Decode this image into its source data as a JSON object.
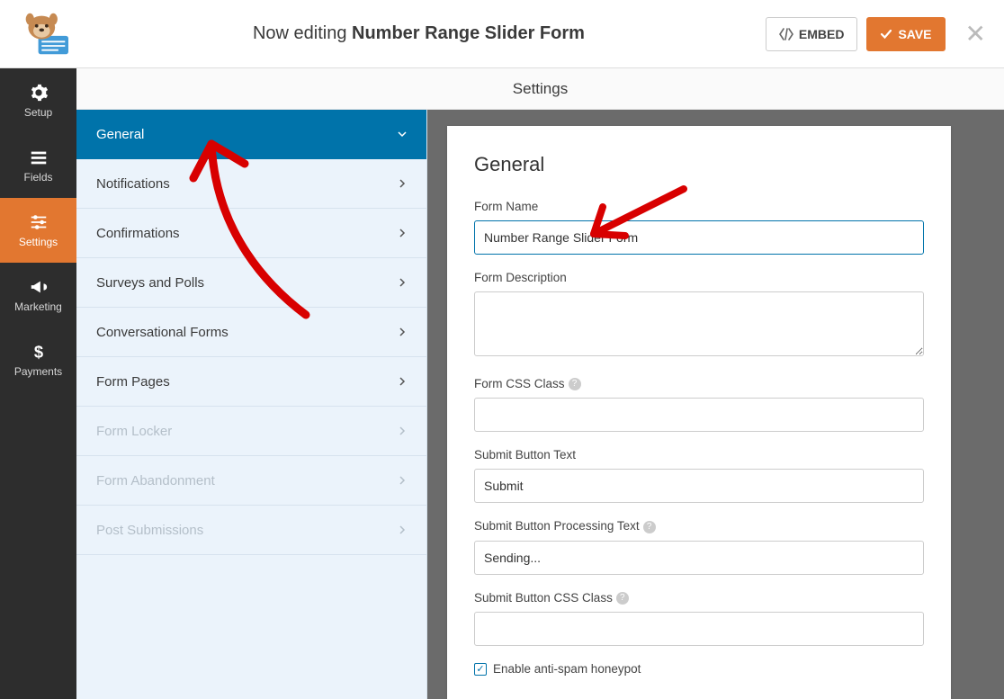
{
  "header": {
    "editing_prefix": "Now editing ",
    "editing_title": "Number Range Slider Form",
    "embed_label": "EMBED",
    "save_label": "SAVE"
  },
  "sidebar": {
    "items": [
      {
        "label": "Setup",
        "icon": "gear"
      },
      {
        "label": "Fields",
        "icon": "list"
      },
      {
        "label": "Settings",
        "icon": "sliders"
      },
      {
        "label": "Marketing",
        "icon": "bullhorn"
      },
      {
        "label": "Payments",
        "icon": "dollar"
      }
    ]
  },
  "section_title": "Settings",
  "menu": {
    "items": [
      {
        "label": "General",
        "active": true,
        "disabled": false
      },
      {
        "label": "Notifications",
        "disabled": false
      },
      {
        "label": "Confirmations",
        "disabled": false
      },
      {
        "label": "Surveys and Polls",
        "disabled": false
      },
      {
        "label": "Conversational Forms",
        "disabled": false
      },
      {
        "label": "Form Pages",
        "disabled": false
      },
      {
        "label": "Form Locker",
        "disabled": true
      },
      {
        "label": "Form Abandonment",
        "disabled": true
      },
      {
        "label": "Post Submissions",
        "disabled": true
      }
    ]
  },
  "panel": {
    "title": "General",
    "form_name_label": "Form Name",
    "form_name_value": "Number Range Slider Form",
    "form_desc_label": "Form Description",
    "form_desc_value": "",
    "css_class_label": "Form CSS Class",
    "css_class_value": "",
    "submit_text_label": "Submit Button Text",
    "submit_text_value": "Submit",
    "submit_proc_label": "Submit Button Processing Text",
    "submit_proc_value": "Sending...",
    "submit_css_label": "Submit Button CSS Class",
    "submit_css_value": "",
    "honeypot_label": "Enable anti-spam honeypot"
  }
}
